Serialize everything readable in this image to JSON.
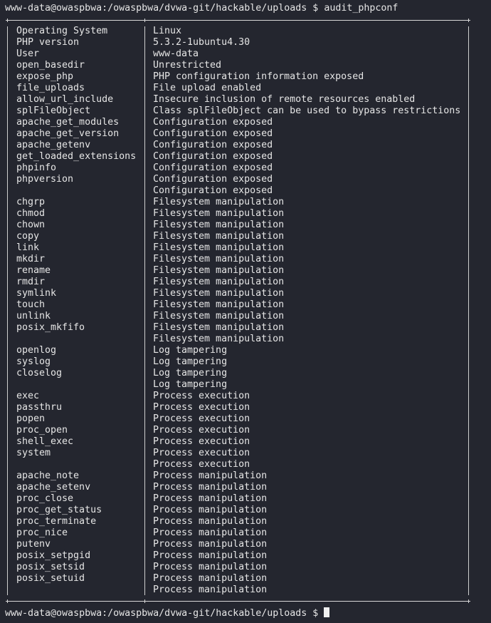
{
  "terminal": {
    "prompt": "www-data@owaspbwa:/owaspbwa/dvwa-git/hackable/uploads $ ",
    "command": "audit_phpconf",
    "rows": [
      [
        "Operating System",
        "Linux"
      ],
      [
        "PHP version",
        "5.3.2-1ubuntu4.30"
      ],
      [
        "User",
        "www-data"
      ],
      [
        "open_basedir",
        "Unrestricted"
      ],
      [
        "expose_php",
        "PHP configuration information exposed"
      ],
      [
        "file_uploads",
        "File upload enabled"
      ],
      [
        "allow_url_include",
        "Insecure inclusion of remote resources enabled"
      ],
      [
        "splFileObject",
        "Class splFileObject can be used to bypass restrictions"
      ],
      [
        "apache_get_modules",
        "Configuration exposed"
      ],
      [
        "apache_get_version",
        "Configuration exposed"
      ],
      [
        "apache_getenv",
        "Configuration exposed"
      ],
      [
        "get_loaded_extensions",
        "Configuration exposed"
      ],
      [
        "phpinfo",
        "Configuration exposed"
      ],
      [
        "phpversion",
        "Configuration exposed"
      ],
      [
        "",
        "Configuration exposed"
      ],
      [
        "chgrp",
        "Filesystem manipulation"
      ],
      [
        "chmod",
        "Filesystem manipulation"
      ],
      [
        "chown",
        "Filesystem manipulation"
      ],
      [
        "copy",
        "Filesystem manipulation"
      ],
      [
        "link",
        "Filesystem manipulation"
      ],
      [
        "mkdir",
        "Filesystem manipulation"
      ],
      [
        "rename",
        "Filesystem manipulation"
      ],
      [
        "rmdir",
        "Filesystem manipulation"
      ],
      [
        "symlink",
        "Filesystem manipulation"
      ],
      [
        "touch",
        "Filesystem manipulation"
      ],
      [
        "unlink",
        "Filesystem manipulation"
      ],
      [
        "posix_mkfifo",
        "Filesystem manipulation"
      ],
      [
        "",
        "Filesystem manipulation"
      ],
      [
        "openlog",
        "Log tampering"
      ],
      [
        "syslog",
        "Log tampering"
      ],
      [
        "closelog",
        "Log tampering"
      ],
      [
        "",
        "Log tampering"
      ],
      [
        "exec",
        "Process execution"
      ],
      [
        "passthru",
        "Process execution"
      ],
      [
        "popen",
        "Process execution"
      ],
      [
        "proc_open",
        "Process execution"
      ],
      [
        "shell_exec",
        "Process execution"
      ],
      [
        "system",
        "Process execution"
      ],
      [
        "",
        "Process execution"
      ],
      [
        "apache_note",
        "Process manipulation"
      ],
      [
        "apache_setenv",
        "Process manipulation"
      ],
      [
        "proc_close",
        "Process manipulation"
      ],
      [
        "proc_get_status",
        "Process manipulation"
      ],
      [
        "proc_terminate",
        "Process manipulation"
      ],
      [
        "proc_nice",
        "Process manipulation"
      ],
      [
        "putenv",
        "Process manipulation"
      ],
      [
        "posix_setpgid",
        "Process manipulation"
      ],
      [
        "posix_setsid",
        "Process manipulation"
      ],
      [
        "posix_setuid",
        "Process manipulation"
      ],
      [
        "",
        "Process manipulation"
      ]
    ]
  }
}
